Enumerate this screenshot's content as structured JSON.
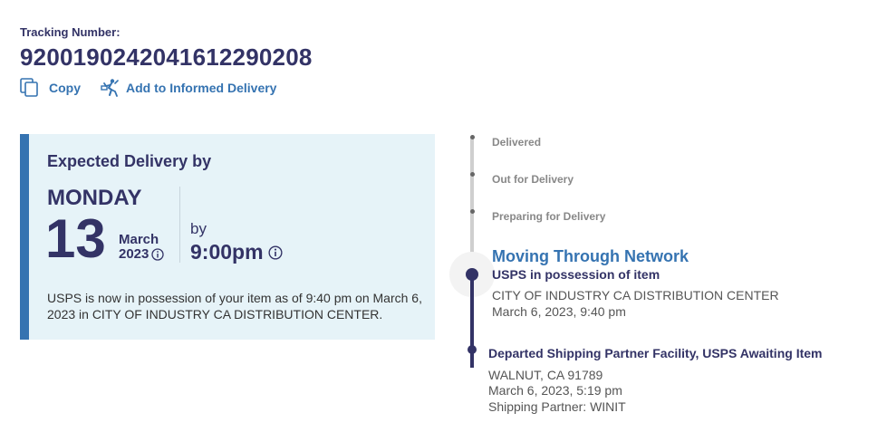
{
  "header": {
    "tracking_label": "Tracking Number:",
    "tracking_number": "9200190242041612290208",
    "copy_label": "Copy",
    "informed_label": "Add to Informed Delivery"
  },
  "expected": {
    "title": "Expected Delivery by",
    "day_name": "MONDAY",
    "day_number": "13",
    "month": "March",
    "year": "2023",
    "by_label": "by",
    "time": "9:00pm",
    "description": "USPS is now in possession of your item as of 9:40 pm on March 6, 2023 in CITY OF INDUSTRY CA DISTRIBUTION CENTER."
  },
  "timeline": {
    "future_steps": [
      "Delivered",
      "Out for Delivery",
      "Preparing for Delivery"
    ],
    "current": {
      "title": "Moving Through Network",
      "subtitle": "USPS in possession of item",
      "location": "CITY OF INDUSTRY CA DISTRIBUTION CENTER",
      "datetime": "March 6, 2023, 9:40 pm"
    },
    "past": {
      "title": "Departed Shipping Partner Facility, USPS Awaiting Item",
      "location": "WALNUT, CA 91789",
      "datetime": "March 6, 2023, 5:19 pm",
      "partner": "Shipping Partner: WINIT"
    }
  },
  "colors": {
    "navy": "#333366",
    "accent_blue": "#3573b1",
    "card_bg": "#e6f3f8",
    "muted": "#888888"
  },
  "icons": [
    "copy-icon",
    "informed-delivery-icon",
    "info-icon"
  ]
}
